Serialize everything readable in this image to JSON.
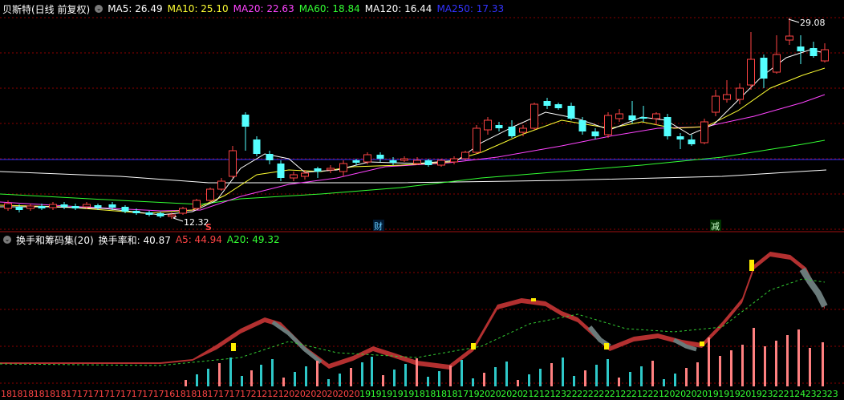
{
  "main_panel": {
    "title": "贝斯特(日线 前复权)",
    "ma_labels": [
      {
        "text": "MA5: 26.49",
        "color": "#ffffff"
      },
      {
        "text": "MA10: 25.10",
        "color": "#ffff33"
      },
      {
        "text": "MA20: 22.63",
        "color": "#ff44ff"
      },
      {
        "text": "MA60: 18.84",
        "color": "#33ff33"
      },
      {
        "text": "MA120: 16.44",
        "color": "#ffffff"
      },
      {
        "text": "MA250: 17.33",
        "color": "#3333ff"
      }
    ],
    "high_label": "29.08",
    "low_label": "12.32",
    "event_markers": [
      "S",
      "财",
      "减"
    ]
  },
  "sub_panel": {
    "title": "换手和筹码集(20)",
    "indicators": [
      {
        "text": "换手率和: 40.87",
        "color": "#ffffff"
      },
      {
        "text": "A5: 44.94",
        "color": "#ff4444"
      },
      {
        "text": "A20: 49.32",
        "color": "#33ff33"
      }
    ],
    "bottom_numbers": [
      "18",
      "18",
      "18",
      "18",
      "18",
      "18",
      "17",
      "17",
      "17",
      "17",
      "17",
      "17",
      "17",
      "17",
      "17",
      "16",
      "18",
      "18",
      "18",
      "17",
      "17",
      "17",
      "17",
      "21",
      "21",
      "21",
      "20",
      "20",
      "20",
      "20",
      "20",
      "20",
      "20",
      "19",
      "19",
      "19",
      "19",
      "19",
      "18",
      "18",
      "18",
      "18",
      "17",
      "19",
      "20",
      "20",
      "20",
      "20",
      "21",
      "21",
      "21",
      "23",
      "22",
      "22",
      "22",
      "22",
      "21",
      "22",
      "21",
      "22",
      "21",
      "20",
      "20",
      "20",
      "20",
      "19",
      "19",
      "19",
      "20",
      "19",
      "23",
      "22",
      "21",
      "24",
      "23",
      "23",
      "23"
    ]
  },
  "colors": {
    "up": "#ff4444",
    "down": "#54ffff",
    "grid": "#8b0000",
    "separator": "#a01010"
  }
}
